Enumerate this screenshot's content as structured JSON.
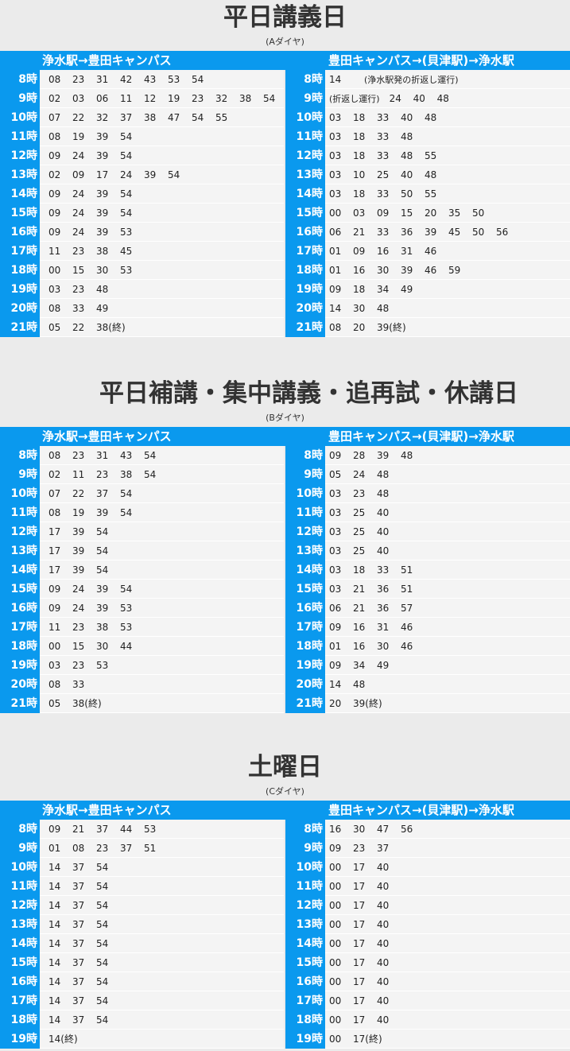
{
  "sections": [
    {
      "title": "平日講義日",
      "subtitle": "(Aダイヤ)",
      "left_header": "浄水駅→豊田キャンパス",
      "right_header": "豊田キャンパス→(貝津駅)→浄水駅",
      "left_rows": [
        {
          "hour": "8時",
          "times": [
            "08",
            "23",
            "31",
            "42",
            "43",
            "53",
            "54"
          ]
        },
        {
          "hour": "9時",
          "times": [
            "02",
            "03",
            "06",
            "11",
            "12",
            "19",
            "23",
            "32",
            "38",
            "54"
          ]
        },
        {
          "hour": "10時",
          "times": [
            "07",
            "22",
            "32",
            "37",
            "38",
            "47",
            "54",
            "55"
          ]
        },
        {
          "hour": "11時",
          "times": [
            "08",
            "19",
            "39",
            "54"
          ]
        },
        {
          "hour": "12時",
          "times": [
            "09",
            "24",
            "39",
            "54"
          ]
        },
        {
          "hour": "13時",
          "times": [
            "02",
            "09",
            "17",
            "24",
            "39",
            "54"
          ]
        },
        {
          "hour": "14時",
          "times": [
            "09",
            "24",
            "39",
            "54"
          ]
        },
        {
          "hour": "15時",
          "times": [
            "09",
            "24",
            "39",
            "54"
          ]
        },
        {
          "hour": "16時",
          "times": [
            "09",
            "24",
            "39",
            "53"
          ]
        },
        {
          "hour": "17時",
          "times": [
            "11",
            "23",
            "38",
            "45"
          ]
        },
        {
          "hour": "18時",
          "times": [
            "00",
            "15",
            "30",
            "53"
          ]
        },
        {
          "hour": "19時",
          "times": [
            "03",
            "23",
            "48"
          ]
        },
        {
          "hour": "20時",
          "times": [
            "08",
            "33",
            "49"
          ]
        },
        {
          "hour": "21時",
          "times": [
            "05",
            "22",
            "38(終)"
          ]
        }
      ],
      "right_rows": [
        {
          "hour": "8時",
          "times": [
            "14"
          ],
          "note": "(浄水駅発の折返し運行)"
        },
        {
          "hour": "9時",
          "lead_note": "(折返し運行)",
          "times": [
            "24",
            "40",
            "48"
          ]
        },
        {
          "hour": "10時",
          "times": [
            "03",
            "18",
            "33",
            "40",
            "48"
          ]
        },
        {
          "hour": "11時",
          "times": [
            "03",
            "18",
            "33",
            "48"
          ]
        },
        {
          "hour": "12時",
          "times": [
            "03",
            "18",
            "33",
            "48",
            "55"
          ]
        },
        {
          "hour": "13時",
          "times": [
            "03",
            "10",
            "25",
            "40",
            "48"
          ]
        },
        {
          "hour": "14時",
          "times": [
            "03",
            "18",
            "33",
            "50",
            "55"
          ]
        },
        {
          "hour": "15時",
          "times": [
            "00",
            "03",
            "09",
            "15",
            "20",
            "35",
            "50"
          ]
        },
        {
          "hour": "16時",
          "times": [
            "06",
            "21",
            "33",
            "36",
            "39",
            "45",
            "50",
            "56"
          ]
        },
        {
          "hour": "17時",
          "times": [
            "01",
            "09",
            "16",
            "31",
            "46"
          ]
        },
        {
          "hour": "18時",
          "times": [
            "01",
            "16",
            "30",
            "39",
            "46",
            "59"
          ]
        },
        {
          "hour": "19時",
          "times": [
            "09",
            "18",
            "34",
            "49"
          ]
        },
        {
          "hour": "20時",
          "times": [
            "14",
            "30",
            "48"
          ]
        },
        {
          "hour": "21時",
          "times": [
            "08",
            "20",
            "39(終)"
          ]
        }
      ]
    },
    {
      "title": "平日補講・集中講義・追再試・休講日",
      "subtitle": "(Bダイヤ)",
      "left_header": "浄水駅→豊田キャンパス",
      "right_header": "豊田キャンパス→(貝津駅)→浄水駅",
      "left_rows": [
        {
          "hour": "8時",
          "times": [
            "08",
            "23",
            "31",
            "43",
            "54"
          ]
        },
        {
          "hour": "9時",
          "times": [
            "02",
            "11",
            "23",
            "38",
            "54"
          ]
        },
        {
          "hour": "10時",
          "times": [
            "07",
            "22",
            "37",
            "54"
          ]
        },
        {
          "hour": "11時",
          "times": [
            "08",
            "19",
            "39",
            "54"
          ]
        },
        {
          "hour": "12時",
          "times": [
            "17",
            "39",
            "54"
          ]
        },
        {
          "hour": "13時",
          "times": [
            "17",
            "39",
            "54"
          ]
        },
        {
          "hour": "14時",
          "times": [
            "17",
            "39",
            "54"
          ]
        },
        {
          "hour": "15時",
          "times": [
            "09",
            "24",
            "39",
            "54"
          ]
        },
        {
          "hour": "16時",
          "times": [
            "09",
            "24",
            "39",
            "53"
          ]
        },
        {
          "hour": "17時",
          "times": [
            "11",
            "23",
            "38",
            "53"
          ]
        },
        {
          "hour": "18時",
          "times": [
            "00",
            "15",
            "30",
            "44"
          ]
        },
        {
          "hour": "19時",
          "times": [
            "03",
            "23",
            "53"
          ]
        },
        {
          "hour": "20時",
          "times": [
            "08",
            "33"
          ]
        },
        {
          "hour": "21時",
          "times": [
            "05",
            "38(終)"
          ]
        }
      ],
      "right_rows": [
        {
          "hour": "8時",
          "times": [
            "09",
            "28",
            "39",
            "48"
          ]
        },
        {
          "hour": "9時",
          "times": [
            "05",
            "24",
            "48"
          ]
        },
        {
          "hour": "10時",
          "times": [
            "03",
            "23",
            "48"
          ]
        },
        {
          "hour": "11時",
          "times": [
            "03",
            "25",
            "40"
          ]
        },
        {
          "hour": "12時",
          "times": [
            "03",
            "25",
            "40"
          ]
        },
        {
          "hour": "13時",
          "times": [
            "03",
            "25",
            "40"
          ]
        },
        {
          "hour": "14時",
          "times": [
            "03",
            "18",
            "33",
            "51"
          ]
        },
        {
          "hour": "15時",
          "times": [
            "03",
            "21",
            "36",
            "51"
          ]
        },
        {
          "hour": "16時",
          "times": [
            "06",
            "21",
            "36",
            "57"
          ]
        },
        {
          "hour": "17時",
          "times": [
            "09",
            "16",
            "31",
            "46"
          ]
        },
        {
          "hour": "18時",
          "times": [
            "01",
            "16",
            "30",
            "46"
          ]
        },
        {
          "hour": "19時",
          "times": [
            "09",
            "34",
            "49"
          ]
        },
        {
          "hour": "20時",
          "times": [
            "14",
            "48"
          ]
        },
        {
          "hour": "21時",
          "times": [
            "20",
            "39(終)"
          ]
        }
      ]
    },
    {
      "title": "土曜日",
      "subtitle": "(Cダイヤ)",
      "left_header": "浄水駅→豊田キャンパス",
      "right_header": "豊田キャンパス→(貝津駅)→浄水駅",
      "left_rows": [
        {
          "hour": "8時",
          "times": [
            "09",
            "21",
            "37",
            "44",
            "53"
          ]
        },
        {
          "hour": "9時",
          "times": [
            "01",
            "08",
            "23",
            "37",
            "51"
          ]
        },
        {
          "hour": "10時",
          "times": [
            "14",
            "37",
            "54"
          ]
        },
        {
          "hour": "11時",
          "times": [
            "14",
            "37",
            "54"
          ]
        },
        {
          "hour": "12時",
          "times": [
            "14",
            "37",
            "54"
          ]
        },
        {
          "hour": "13時",
          "times": [
            "14",
            "37",
            "54"
          ]
        },
        {
          "hour": "14時",
          "times": [
            "14",
            "37",
            "54"
          ]
        },
        {
          "hour": "15時",
          "times": [
            "14",
            "37",
            "54"
          ]
        },
        {
          "hour": "16時",
          "times": [
            "14",
            "37",
            "54"
          ]
        },
        {
          "hour": "17時",
          "times": [
            "14",
            "37",
            "54"
          ]
        },
        {
          "hour": "18時",
          "times": [
            "14",
            "37",
            "54"
          ]
        },
        {
          "hour": "19時",
          "times": [
            "14(終)"
          ]
        }
      ],
      "right_rows": [
        {
          "hour": "8時",
          "times": [
            "16",
            "30",
            "47",
            "56"
          ]
        },
        {
          "hour": "9時",
          "times": [
            "09",
            "23",
            "37"
          ]
        },
        {
          "hour": "10時",
          "times": [
            "00",
            "17",
            "40"
          ]
        },
        {
          "hour": "11時",
          "times": [
            "00",
            "17",
            "40"
          ]
        },
        {
          "hour": "12時",
          "times": [
            "00",
            "17",
            "40"
          ]
        },
        {
          "hour": "13時",
          "times": [
            "00",
            "17",
            "40"
          ]
        },
        {
          "hour": "14時",
          "times": [
            "00",
            "17",
            "40"
          ]
        },
        {
          "hour": "15時",
          "times": [
            "00",
            "17",
            "40"
          ]
        },
        {
          "hour": "16時",
          "times": [
            "00",
            "17",
            "40"
          ]
        },
        {
          "hour": "17時",
          "times": [
            "00",
            "17",
            "40"
          ]
        },
        {
          "hour": "18時",
          "times": [
            "00",
            "17",
            "40"
          ]
        },
        {
          "hour": "19時",
          "times": [
            "00",
            "17(終)"
          ]
        }
      ]
    }
  ]
}
